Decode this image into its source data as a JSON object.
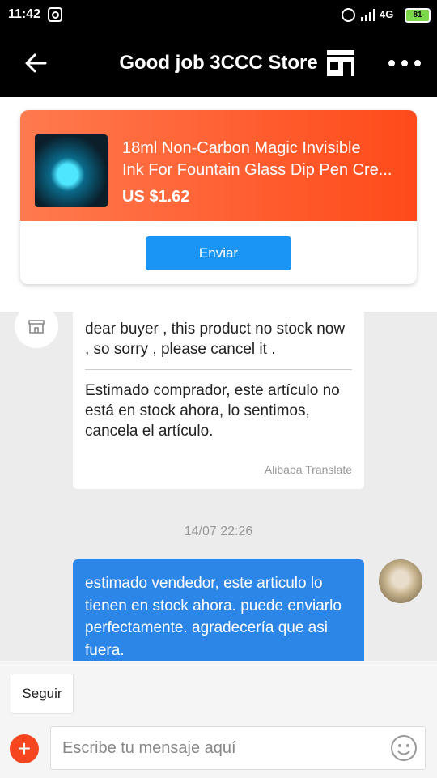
{
  "status_bar": {
    "time": "11:42",
    "network": "4G",
    "battery": "81"
  },
  "header": {
    "title": "Good job 3CCC Store",
    "back_icon": "arrow-left-icon",
    "store_icon": "store-icon",
    "more_icon": "more-dots-icon"
  },
  "product_card": {
    "name_line1": "18ml Non-Carbon Magic Invisible",
    "name_line2": "Ink For Fountain Glass Dip Pen Cre...",
    "price": "US $1.62",
    "send_label": "Enviar"
  },
  "messages": [
    {
      "direction": "incoming",
      "text": "dear buyer , this product no stock now , so sorry , please cancel it .",
      "translation": "Estimado comprador, este artículo no está en stock ahora, lo sentimos, cancela el artículo.",
      "translation_source": "Alibaba Translate"
    },
    {
      "direction": "outgoing",
      "timestamp": "14/07 22:26",
      "text": "estimado vendedor, este articulo lo tienen en stock ahora. puede enviarlo perfectamente. agradecería que asi fuera."
    }
  ],
  "bottom": {
    "follow_label": "Seguir",
    "add_label": "+",
    "input_placeholder": "Escribe tu mensaje aquí",
    "emoji_icon": "emoji-icon"
  },
  "colors": {
    "header_bg": "#000000",
    "product_gradient_start": "#ff7a4f",
    "product_gradient_end": "#ff4a1a",
    "send_button": "#1b95f5",
    "outgoing_bubble": "#2c86e8",
    "plus_button": "#f5461f"
  }
}
